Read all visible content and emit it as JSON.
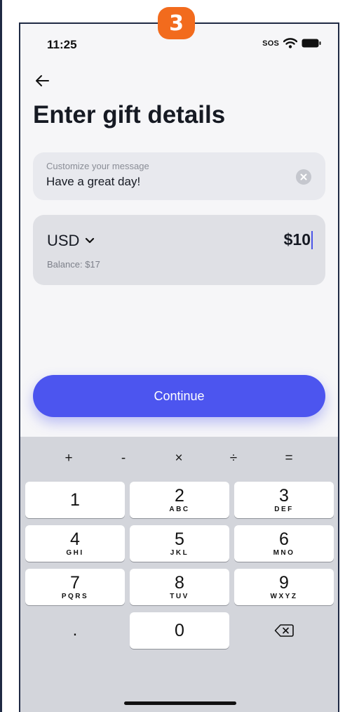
{
  "step_badge": "3",
  "status_bar": {
    "time": "11:25",
    "sos": "SOS"
  },
  "page": {
    "title": "Enter gift details"
  },
  "message": {
    "label": "Customize your message",
    "value": "Have a great day!"
  },
  "amount": {
    "currency": "USD",
    "value": "$10",
    "balance": "Balance: $17"
  },
  "continue_label": "Continue",
  "keyboard": {
    "operators": [
      "+",
      "-",
      "×",
      "÷",
      "="
    ],
    "keys": [
      {
        "digit": "1",
        "letters": ""
      },
      {
        "digit": "2",
        "letters": "ABC"
      },
      {
        "digit": "3",
        "letters": "DEF"
      },
      {
        "digit": "4",
        "letters": "GHI"
      },
      {
        "digit": "5",
        "letters": "JKL"
      },
      {
        "digit": "6",
        "letters": "MNO"
      },
      {
        "digit": "7",
        "letters": "PQRS"
      },
      {
        "digit": "8",
        "letters": "TUV"
      },
      {
        "digit": "9",
        "letters": "WXYZ"
      }
    ],
    "decimal": ".",
    "zero": "0"
  },
  "colors": {
    "accent": "#4c55ef",
    "step_badge": "#f26b1d"
  },
  "icons": {
    "back": "arrow-left-icon",
    "clear": "clear-x-icon",
    "dropdown": "chevron-down-icon",
    "delete": "backspace-icon",
    "wifi": "wifi-icon",
    "battery": "battery-icon"
  }
}
